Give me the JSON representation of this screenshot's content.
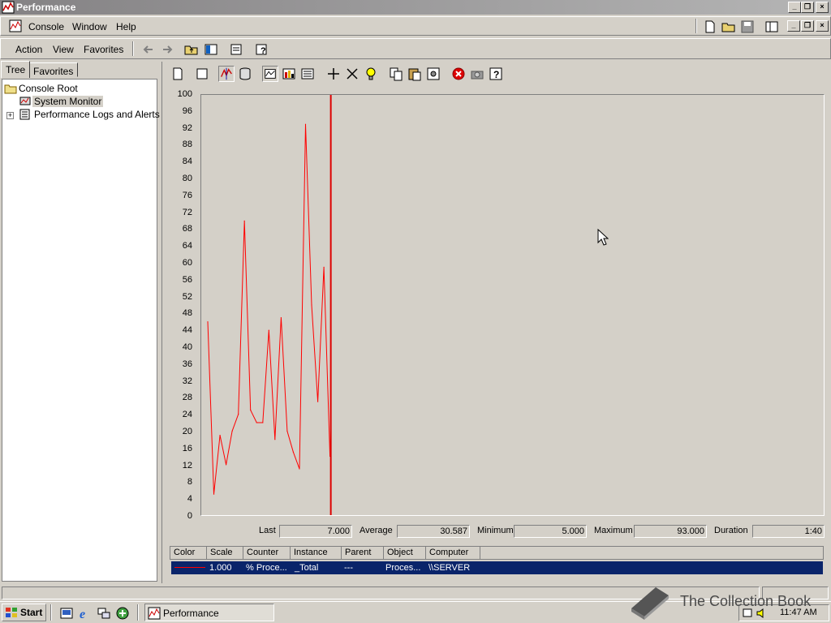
{
  "window": {
    "title": "Performance"
  },
  "menubar": {
    "items": [
      "Console",
      "Window",
      "Help"
    ]
  },
  "action_bar": {
    "items": [
      "Action",
      "View",
      "Favorites"
    ]
  },
  "tabs": [
    "Tree",
    "Favorites"
  ],
  "tree": {
    "root": "Console Root",
    "items": [
      "System Monitor",
      "Performance Logs and Alerts"
    ]
  },
  "chart_data": {
    "type": "line",
    "ylim": [
      0,
      100
    ],
    "yticks": [
      "100",
      "96",
      "92",
      "88",
      "84",
      "80",
      "76",
      "72",
      "68",
      "64",
      "60",
      "56",
      "52",
      "48",
      "44",
      "40",
      "36",
      "32",
      "28",
      "24",
      "20",
      "16",
      "12",
      "8",
      "4",
      "0"
    ],
    "series": [
      {
        "color": "#ff0000",
        "x": [
          1,
          2,
          3,
          4,
          5,
          6,
          7,
          8,
          9,
          10,
          11,
          12,
          13,
          14,
          15,
          16,
          17,
          18,
          19,
          20,
          21
        ],
        "values": [
          46,
          5,
          19,
          12,
          20,
          24,
          70,
          25,
          22,
          22,
          44,
          18,
          47,
          20,
          15,
          11,
          93,
          50,
          27,
          59,
          14
        ]
      }
    ],
    "x_range": [
      1,
      100
    ],
    "time_bar_at": 21
  },
  "stats": {
    "last_label": "Last",
    "last": "7.000",
    "average_label": "Average",
    "average": "30.587",
    "minimum_label": "Minimum",
    "minimum": "5.000",
    "maximum_label": "Maximum",
    "maximum": "93.000",
    "duration_label": "Duration",
    "duration": "1:40"
  },
  "legend": {
    "headers": [
      "Color",
      "Scale",
      "Counter",
      "Instance",
      "Parent",
      "Object",
      "Computer"
    ],
    "row": {
      "scale": "1.000",
      "counter": "% Proce...",
      "instance": "_Total",
      "parent": "---",
      "object": "Proces...",
      "computer": "\\\\SERVER"
    }
  },
  "taskbar": {
    "start": "Start",
    "task": "Performance",
    "clock": "11:47 AM"
  },
  "watermark": "The Collection Book"
}
